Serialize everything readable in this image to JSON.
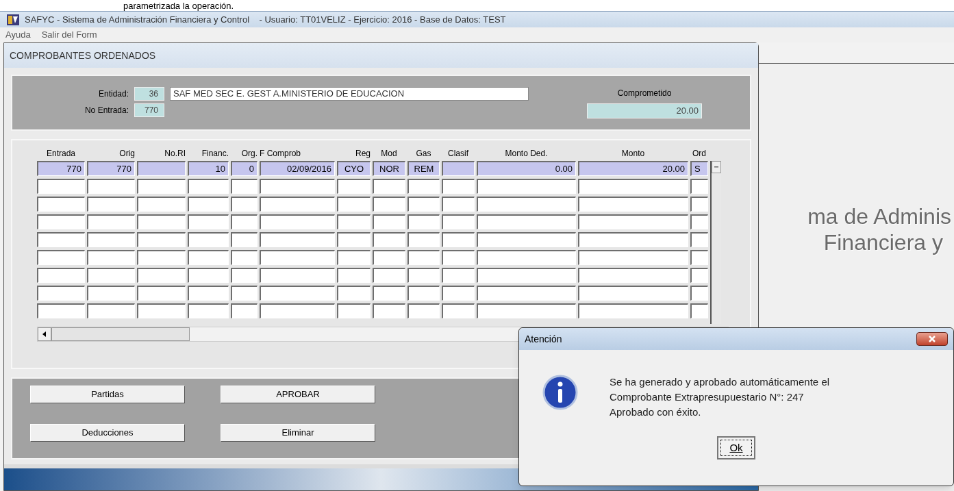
{
  "caption": "parametrizada la operación.",
  "window": {
    "title": "SAFYC - Sistema de Administración Financiera y Control    - Usuario: TT01VELIZ - Ejercicio: 2016 - Base de Datos: TEST"
  },
  "menu": [
    "Ayuda",
    "Salir del Form"
  ],
  "form": {
    "title": "COMPROBANTES ORDENADOS",
    "entidad": {
      "label": "Entidad:",
      "code": "36",
      "name": "SAF MED SEC E. GEST A.MINISTERIO DE EDUCACION"
    },
    "no_entrada": {
      "label": "No Entrada:",
      "value": "770"
    },
    "comprometido": {
      "label": "Comprometido",
      "value": "20.00"
    },
    "table": {
      "columns": [
        "Entrada",
        "Orig",
        "No.RI",
        "Financ.",
        "Org.",
        "F Comprob",
        "Reg",
        "Mod",
        "Gas",
        "Clasif",
        "Monto Ded.",
        "Monto",
        "Ord"
      ],
      "rows": [
        {
          "selected": true,
          "cells": [
            "770",
            "770",
            null,
            "10",
            "0",
            "02/09/2016",
            "CYO",
            "NOR",
            "REM",
            null,
            "0.00",
            "20.00",
            "S"
          ]
        }
      ]
    },
    "buttons": [
      [
        "Partidas",
        "APROBAR"
      ],
      [
        "Deducciones",
        "Eliminar"
      ]
    ]
  },
  "background": {
    "lines": [
      "ma de Adminis",
      "Financiera y"
    ]
  },
  "dialog": {
    "title": "Atención",
    "message": [
      "Se ha generado y aprobado automáticamente el",
      "Comprobante Extrapresupuestario N°: 247",
      "Aprobado con éxito."
    ],
    "button": "Ok"
  }
}
